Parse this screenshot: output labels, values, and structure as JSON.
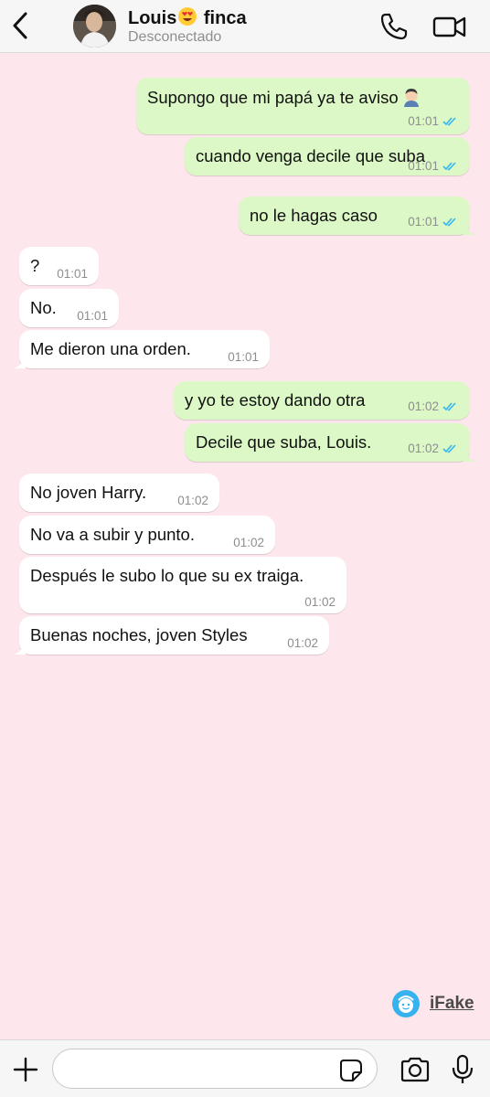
{
  "header": {
    "contact_name_before": "Louis",
    "contact_name_emoji": "heart-eyes-emoji",
    "contact_name_after": " finca",
    "status": "Desconectado"
  },
  "colors": {
    "chat_background": "#fde6ec",
    "outgoing_bubble": "#dcf8c6",
    "incoming_bubble": "#ffffff",
    "read_ticks": "#34b7f1",
    "header_background": "#f6f6f6"
  },
  "messages": [
    {
      "direction": "out",
      "text": "Supongo que mi papá ya te aviso",
      "emoji": "man-facepalming-emoji",
      "time": "01:01",
      "status": "read"
    },
    {
      "direction": "out",
      "text": "cuando venga decile que suba",
      "time": "01:01",
      "status": "read"
    },
    {
      "direction": "out",
      "text": "no le hagas caso",
      "time": "01:01",
      "status": "read"
    },
    {
      "direction": "in",
      "text": "?",
      "time": "01:01"
    },
    {
      "direction": "in",
      "text": "No.",
      "time": "01:01"
    },
    {
      "direction": "in",
      "text": "Me dieron una orden.",
      "time": "01:01"
    },
    {
      "direction": "out",
      "text": "y yo te estoy dando otra",
      "time": "01:02",
      "status": "read"
    },
    {
      "direction": "out",
      "text": "Decile que suba, Louis.",
      "time": "01:02",
      "status": "read"
    },
    {
      "direction": "in",
      "text": "No joven Harry.",
      "time": "01:02"
    },
    {
      "direction": "in",
      "text": "No va a subir y punto.",
      "time": "01:02"
    },
    {
      "direction": "in",
      "text": "Después le subo lo que su ex traiga.",
      "time": "01:02"
    },
    {
      "direction": "in",
      "text": "Buenas noches, joven Styles",
      "time": "01:02"
    }
  ],
  "watermark": {
    "label": "iFake"
  },
  "composer": {
    "placeholder": "",
    "value": ""
  }
}
